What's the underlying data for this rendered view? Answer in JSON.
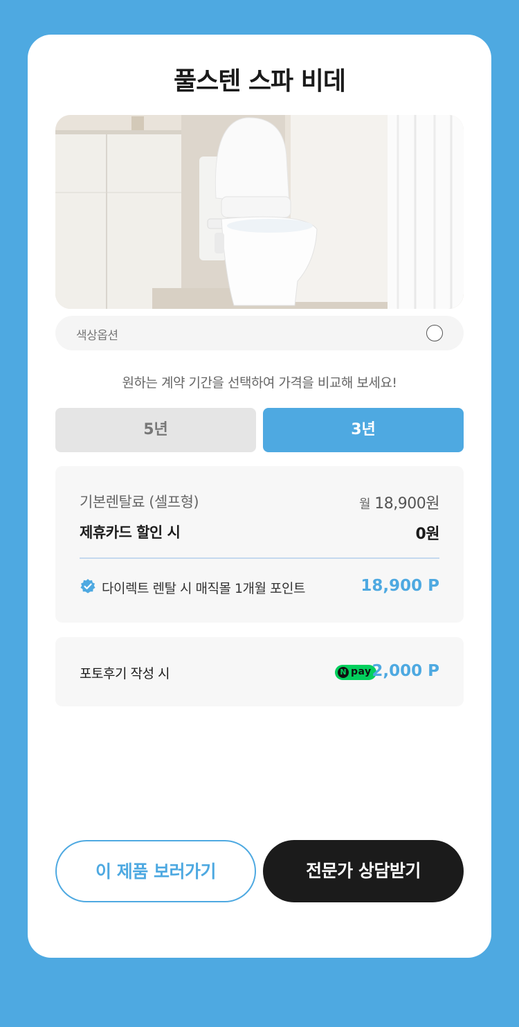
{
  "product": {
    "title": "풀스텐 스파 비데",
    "image_alt": "bidet toilet in bathroom"
  },
  "color_option": {
    "label": "색상옵션"
  },
  "guide_text": "원하는 계약 기간을 선택하여 가격을 비교해 보세요!",
  "contract_tabs": [
    {
      "label": "5년",
      "selected": false
    },
    {
      "label": "3년",
      "selected": true
    }
  ],
  "pricing": {
    "base_label": "기본렌탈료 (셀프형)",
    "base_prefix": "월",
    "base_value": "18,900원",
    "card_label": "제휴카드 할인 시",
    "card_value": "0원",
    "point_label": "다이렉트 렌탈 시 매직몰 1개월 포인트",
    "point_value": "18,900 P"
  },
  "review": {
    "label": "포토후기 작성 시",
    "pay_badge_n": "N",
    "pay_badge_text": "pay",
    "value": "2,000 P"
  },
  "buttons": {
    "view_label": "이 제품 보러가기",
    "consult_label": "전문가 상담받기"
  },
  "colors": {
    "accent": "#4ea9e1",
    "dark": "#1b1b1b",
    "npay_green": "#03cf5d"
  }
}
